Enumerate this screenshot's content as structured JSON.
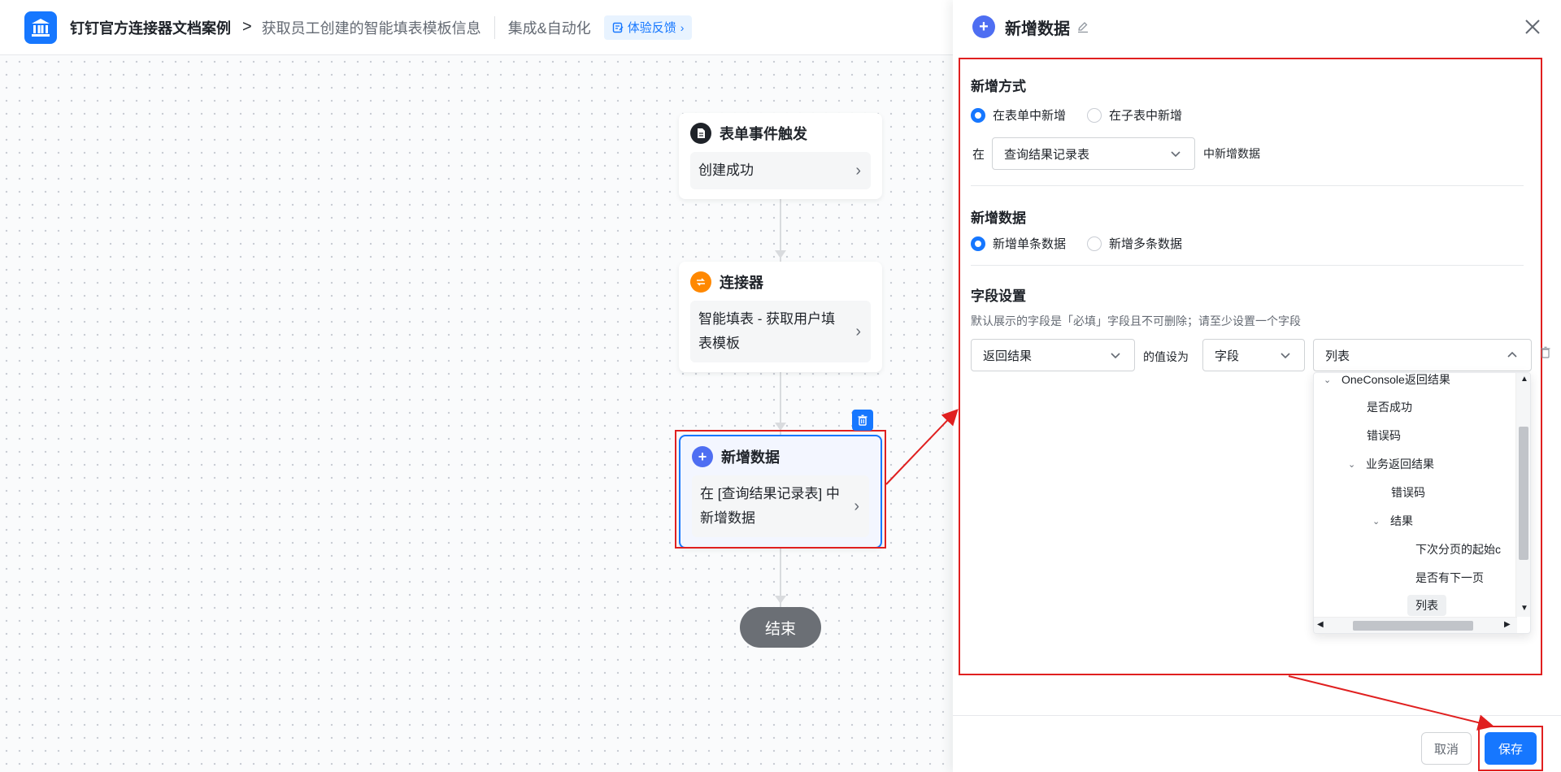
{
  "header": {
    "app_name": "钉钉官方连接器文档案例",
    "breadcrumb_sep": ">",
    "flow_name": "获取员工创建的智能填表模板信息",
    "nav_link": "集成&自动化",
    "feedback": "体验反馈"
  },
  "flow": {
    "nodes": [
      {
        "title": "表单事件触发",
        "body": "创建成功",
        "icon_color": "#1f2329"
      },
      {
        "title": "连接器",
        "body": "智能填表 - 获取用户填表模板",
        "icon_color": "#ff8800"
      },
      {
        "title": "新增数据",
        "body": "在 [查询结果记录表] 中新增数据",
        "icon_color": "#4e6ef2"
      }
    ],
    "end_label": "结束"
  },
  "panel": {
    "title": "新增数据",
    "add_mode": {
      "title": "新增方式",
      "options": [
        "在表单中新增",
        "在子表中新增"
      ],
      "selected": 0,
      "prefix": "在",
      "table_select": "查询结果记录表",
      "suffix": "中新增数据"
    },
    "add_data": {
      "title": "新增数据",
      "options": [
        "新增单条数据",
        "新增多条数据"
      ],
      "selected": 0
    },
    "field_settings": {
      "title": "字段设置",
      "hint": "默认展示的字段是「必填」字段且不可删除；请至少设置一个字段",
      "field_select": "返回结果",
      "value_label": "的值设为",
      "type_select": "字段",
      "value_select": "列表"
    },
    "tree": [
      {
        "label": "OneConsole返回结果",
        "expanded": true
      },
      {
        "label": "是否成功"
      },
      {
        "label": "错误码"
      },
      {
        "label": "业务返回结果",
        "expanded": true
      },
      {
        "label": "错误码"
      },
      {
        "label": "结果",
        "expanded": true
      },
      {
        "label": "下次分页的起始c"
      },
      {
        "label": "是否有下一页"
      },
      {
        "label": "列表",
        "selected": true
      }
    ],
    "cancel": "取消",
    "save": "保存"
  },
  "colors": {
    "primary": "#1677ff",
    "highlight": "#e02020"
  }
}
